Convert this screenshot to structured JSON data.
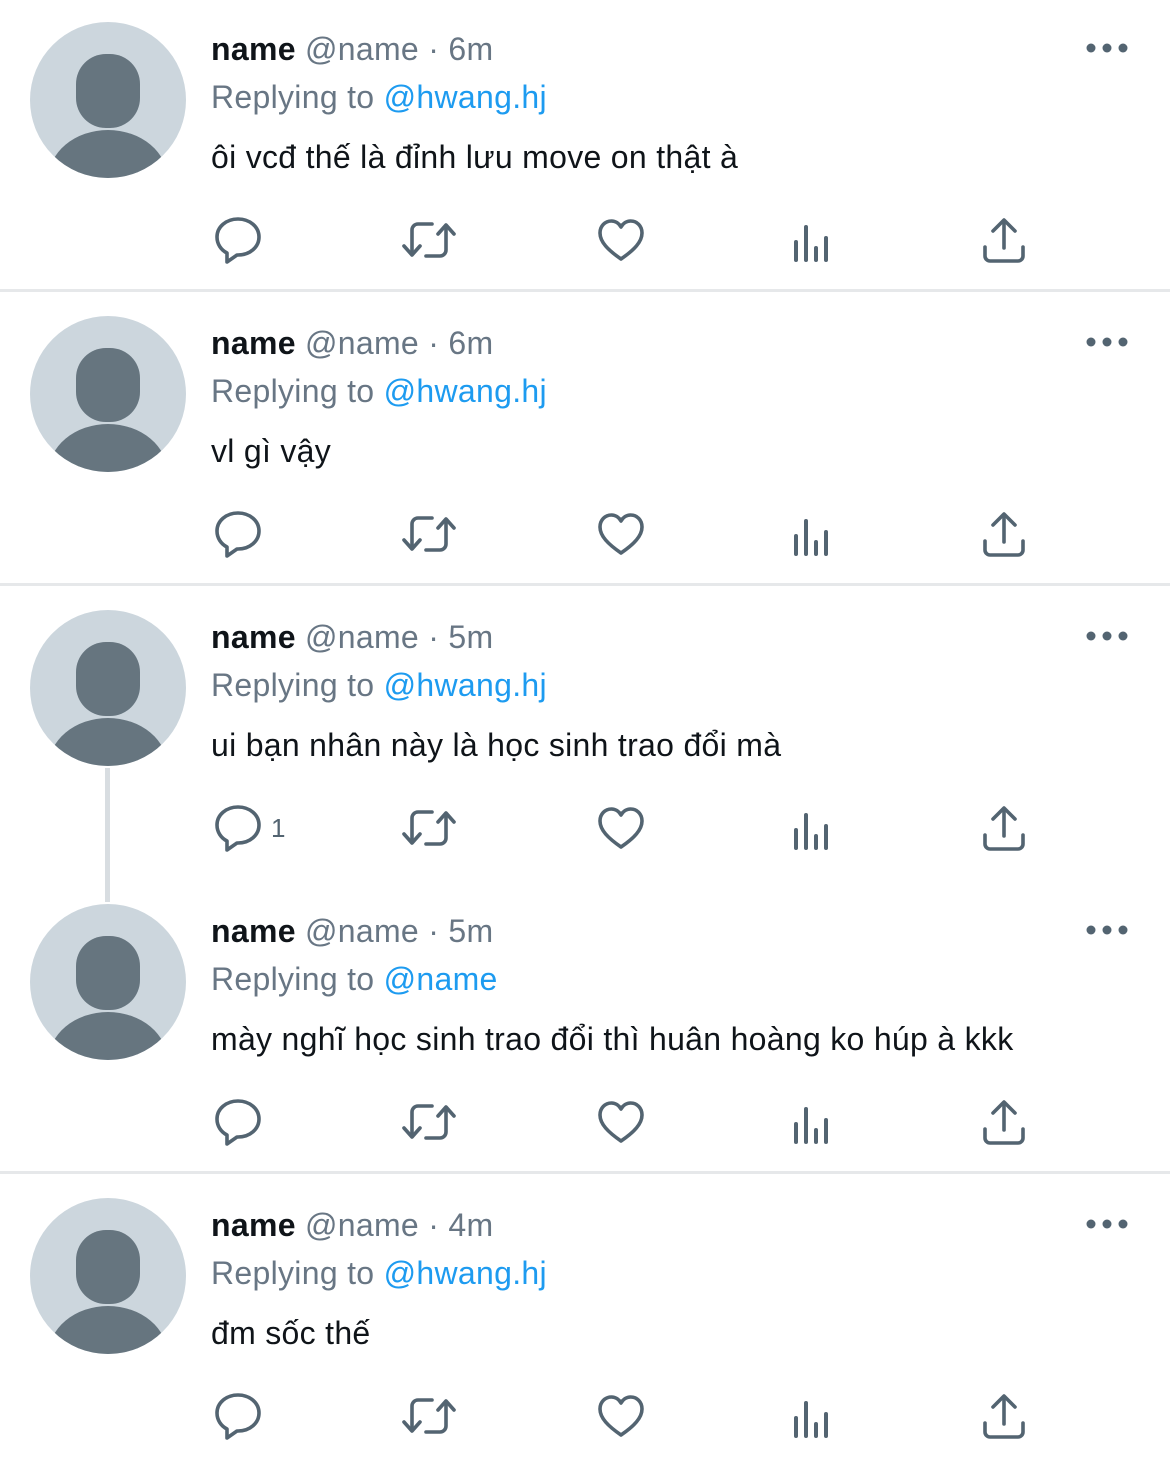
{
  "colors": {
    "mention": "#1d9bf0",
    "secondary_text": "#687684",
    "icon": "#536471",
    "avatar_bg": "#ccd6dd",
    "avatar_fg": "#66757f"
  },
  "icons": {
    "more": "more-horizontal-icon",
    "reply": "reply-bubble-icon",
    "retweet": "retweet-icon",
    "like": "heart-icon",
    "views": "analytics-bars-icon",
    "share": "share-upload-icon"
  },
  "replying_label": "Replying to",
  "tweets": [
    {
      "display_name": "name",
      "handle": "@name",
      "separator": "·",
      "time": "6m",
      "reply_to": "@hwang.hj",
      "text": "ôi vcđ thế là đỉnh lưu move on thật à",
      "reply_count": ""
    },
    {
      "display_name": "name",
      "handle": "@name",
      "separator": "·",
      "time": "6m",
      "reply_to": "@hwang.hj",
      "text": "vl gì vậy",
      "reply_count": ""
    },
    {
      "display_name": "name",
      "handle": "@name",
      "separator": "·",
      "time": "5m",
      "reply_to": "@hwang.hj",
      "text": "ui bạn nhân này là học sinh trao đổi mà",
      "reply_count": "1"
    },
    {
      "display_name": "name",
      "handle": "@name",
      "separator": "·",
      "time": "5m",
      "reply_to": "@name",
      "text": "mày nghĩ học sinh trao đổi thì huân hoàng ko húp à kkk",
      "reply_count": ""
    },
    {
      "display_name": "name",
      "handle": "@name",
      "separator": "·",
      "time": "4m",
      "reply_to": "@hwang.hj",
      "text": "đm sốc thế",
      "reply_count": ""
    }
  ]
}
